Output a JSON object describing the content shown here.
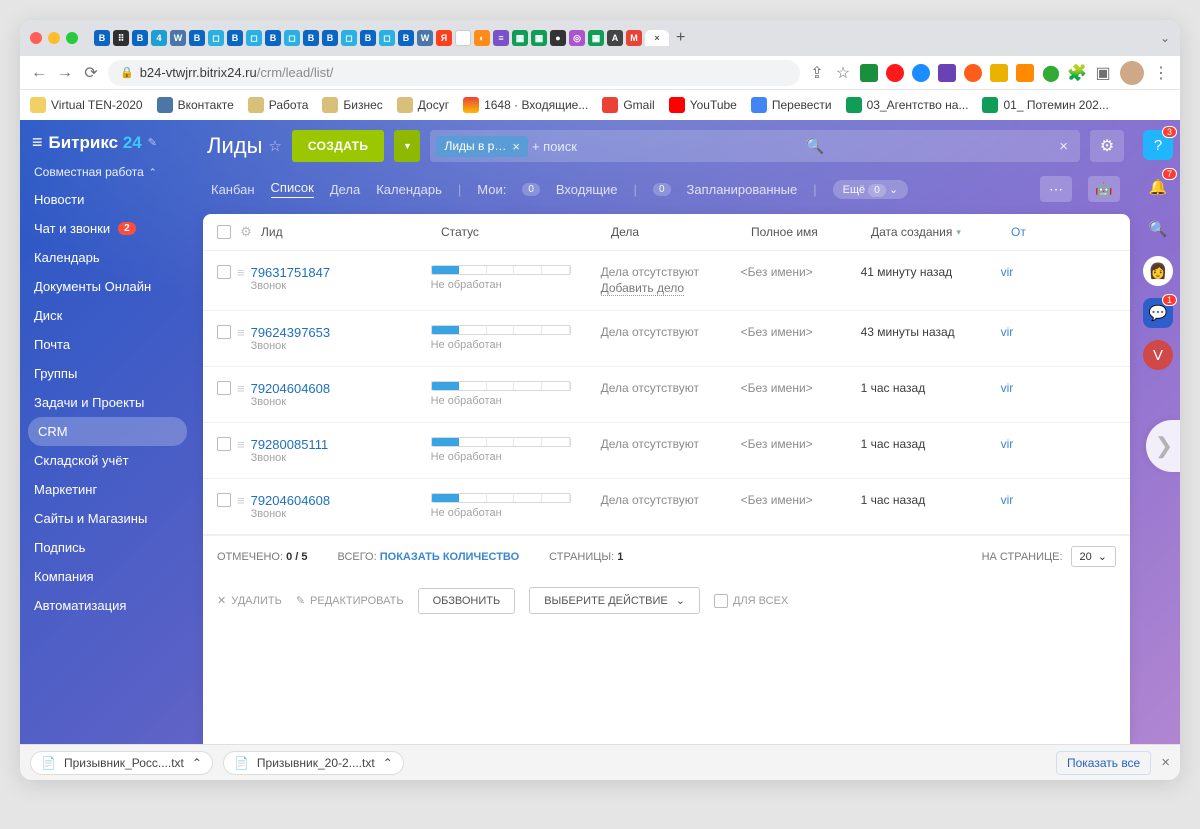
{
  "browser": {
    "url_host": "b24-vtwjrr.bitrix24.ru",
    "url_path": "/crm/lead/list/",
    "bookmarks": [
      "Virtual TEN-2020",
      "Вконтакте",
      "Работа",
      "Бизнес",
      "Досуг",
      "1648 · Входящие...",
      "Gmail",
      "YouTube",
      "Перевести",
      "03_Агентство на...",
      "01_ Потемин 202..."
    ]
  },
  "brand": {
    "name": "Битрикс",
    "num": "24"
  },
  "sidebar": {
    "group": "Совместная работа",
    "items": [
      {
        "label": "Новости"
      },
      {
        "label": "Чат и звонки",
        "badge": "2"
      },
      {
        "label": "Календарь"
      },
      {
        "label": "Документы Онлайн"
      },
      {
        "label": "Диск"
      },
      {
        "label": "Почта"
      },
      {
        "label": "Группы"
      },
      {
        "label": "Задачи и Проекты"
      },
      {
        "label": "CRM",
        "active": true
      },
      {
        "label": "Складской учёт"
      },
      {
        "label": "Маркетинг"
      },
      {
        "label": "Сайты и Магазины"
      },
      {
        "label": "Подпись"
      },
      {
        "label": "Компания"
      },
      {
        "label": "Автоматизация"
      }
    ]
  },
  "page": {
    "title": "Лиды",
    "create": "СОЗДАТЬ",
    "filter_chip": "Лиды в р…",
    "search_ph": "+ поиск",
    "view_tabs": [
      "Канбан",
      "Список",
      "Дела",
      "Календарь"
    ],
    "active_view": "Список",
    "mine": "Мои:",
    "incoming": "Входящие",
    "planned": "Запланированные",
    "more": "Ещё",
    "zero": "0"
  },
  "table": {
    "cols": {
      "lead": "Лид",
      "status": "Статус",
      "deal": "Дела",
      "name": "Полное имя",
      "date": "Дата создания",
      "resp": "От"
    },
    "rows": [
      {
        "num": "79631751847",
        "sub": "Звонок",
        "status": "Не обработан",
        "deal": "Дела отсутствуют",
        "add": "Добавить дело",
        "name": "<Без имени>",
        "date": "41 минуту назад",
        "resp": "vir"
      },
      {
        "num": "79624397653",
        "sub": "Звонок",
        "status": "Не обработан",
        "deal": "Дела отсутствуют",
        "name": "<Без имени>",
        "date": "43 минуты назад",
        "resp": "vir"
      },
      {
        "num": "79204604608",
        "sub": "Звонок",
        "status": "Не обработан",
        "deal": "Дела отсутствуют",
        "name": "<Без имени>",
        "date": "1 час назад",
        "resp": "vir"
      },
      {
        "num": "79280085111",
        "sub": "Звонок",
        "status": "Не обработан",
        "deal": "Дела отсутствуют",
        "name": "<Без имени>",
        "date": "1 час назад",
        "resp": "vir"
      },
      {
        "num": "79204604608",
        "sub": "Звонок",
        "status": "Не обработан",
        "deal": "Дела отсутствуют",
        "name": "<Без имени>",
        "date": "1 час назад",
        "resp": "vir"
      }
    ],
    "selected_lbl": "ОТМЕЧЕНО:",
    "selected": "0 / 5",
    "total_lbl": "ВСЕГО:",
    "total_link": "ПОКАЗАТЬ КОЛИЧЕСТВО",
    "pages_lbl": "СТРАНИЦЫ:",
    "pages": "1",
    "per_lbl": "НА СТРАНИЦЕ:",
    "per": "20"
  },
  "actions": {
    "del": "УДАЛИТЬ",
    "edit": "РЕДАКТИРОВАТЬ",
    "call": "ОБЗВОНИТЬ",
    "sel": "ВЫБЕРИТЕ ДЕЙСТВИЕ",
    "all": "ДЛЯ ВСЕХ"
  },
  "rail": {
    "help": "?",
    "helpb": "3",
    "bellb": "7",
    "groupb": "1",
    "avatar": "V"
  },
  "downloads": {
    "f1": "Призывник_Росс....txt",
    "f2": "Призывник_20-2....txt",
    "show": "Показать все"
  }
}
